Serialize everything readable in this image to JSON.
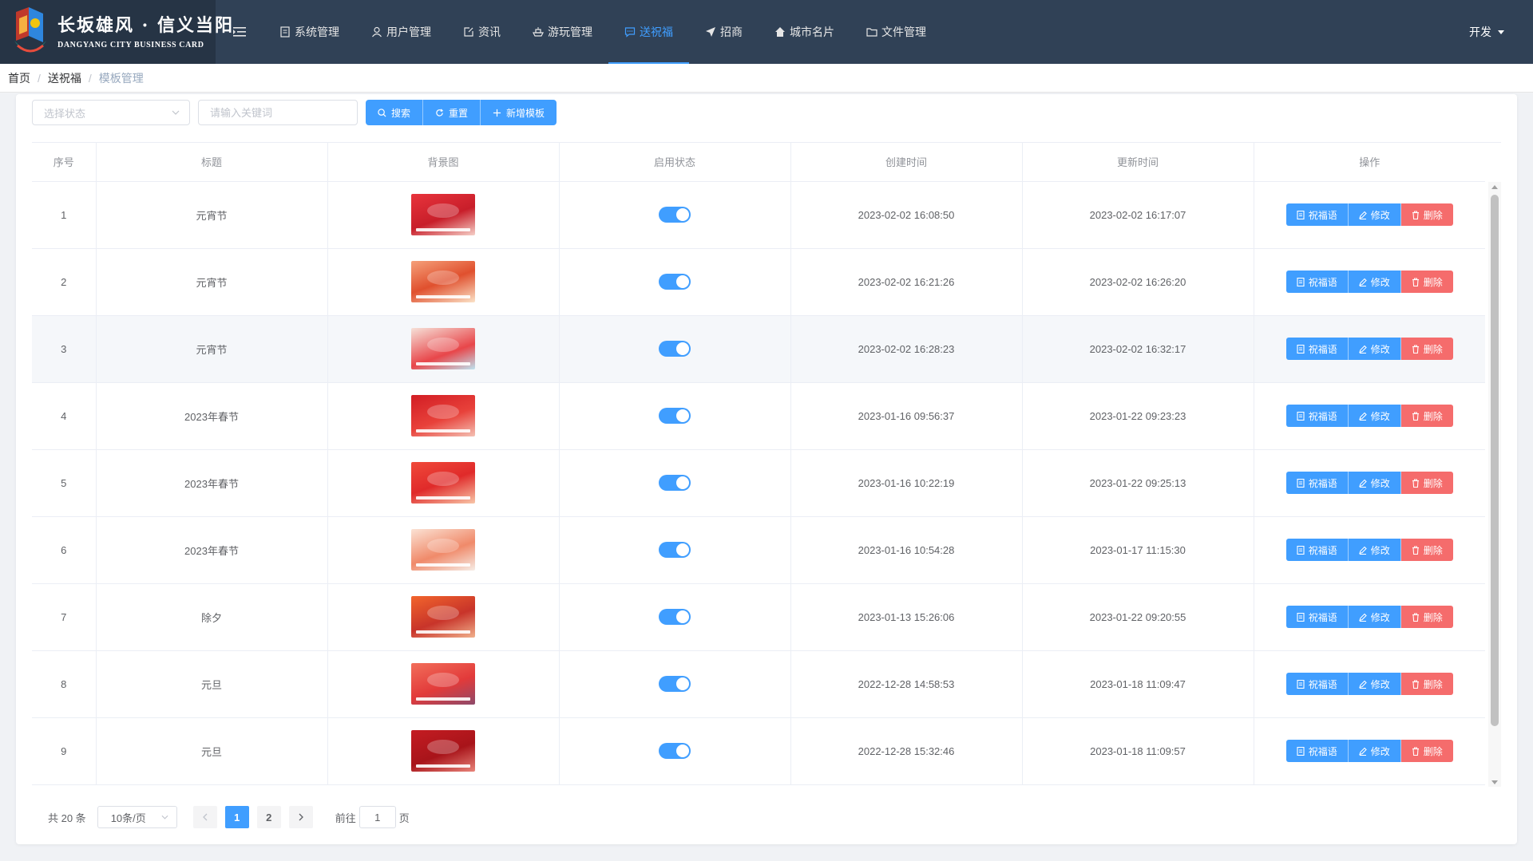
{
  "header": {
    "logo_title": "长坂雄风 · 信义当阳",
    "logo_subtitle": "DANGYANG CITY BUSINESS CARD",
    "nav": [
      {
        "label": "系统管理",
        "icon": "document-icon"
      },
      {
        "label": "用户管理",
        "icon": "user-icon"
      },
      {
        "label": "资讯",
        "icon": "edit-icon"
      },
      {
        "label": "游玩管理",
        "icon": "ship-icon"
      },
      {
        "label": "送祝福",
        "icon": "chat-icon",
        "active": true
      },
      {
        "label": "招商",
        "icon": "send-icon"
      },
      {
        "label": "城市名片",
        "icon": "home-icon"
      },
      {
        "label": "文件管理",
        "icon": "folder-icon"
      }
    ],
    "user_name": "开发"
  },
  "breadcrumb": [
    "首页",
    "送祝福",
    "模板管理"
  ],
  "filters": {
    "status_placeholder": "选择状态",
    "keyword_placeholder": "请输入关键词",
    "search_label": "搜索",
    "reset_label": "重置",
    "add_label": "新增模板"
  },
  "table": {
    "columns": [
      "序号",
      "标题",
      "背景图",
      "启用状态",
      "创建时间",
      "更新时间",
      "操作"
    ],
    "actions": {
      "blessing": "祝福语",
      "edit": "修改",
      "delete": "删除"
    },
    "rows": [
      {
        "index": "1",
        "title": "元宵节",
        "enabled": true,
        "created": "2023-02-02 16:08:50",
        "updated": "2023-02-02 16:17:07"
      },
      {
        "index": "2",
        "title": "元宵节",
        "enabled": true,
        "created": "2023-02-02 16:21:26",
        "updated": "2023-02-02 16:26:20"
      },
      {
        "index": "3",
        "title": "元宵节",
        "enabled": true,
        "created": "2023-02-02 16:28:23",
        "updated": "2023-02-02 16:32:17"
      },
      {
        "index": "4",
        "title": "2023年春节",
        "enabled": true,
        "created": "2023-01-16 09:56:37",
        "updated": "2023-01-22 09:23:23"
      },
      {
        "index": "5",
        "title": "2023年春节",
        "enabled": true,
        "created": "2023-01-16 10:22:19",
        "updated": "2023-01-22 09:25:13"
      },
      {
        "index": "6",
        "title": "2023年春节",
        "enabled": true,
        "created": "2023-01-16 10:54:28",
        "updated": "2023-01-17 11:15:30"
      },
      {
        "index": "7",
        "title": "除夕",
        "enabled": true,
        "created": "2023-01-13 15:26:06",
        "updated": "2023-01-22 09:20:55"
      },
      {
        "index": "8",
        "title": "元旦",
        "enabled": true,
        "created": "2022-12-28 14:58:53",
        "updated": "2023-01-18 11:09:47"
      },
      {
        "index": "9",
        "title": "元旦",
        "enabled": true,
        "created": "2022-12-28 15:32:46",
        "updated": "2023-01-18 11:09:57"
      }
    ]
  },
  "pagination": {
    "total_text": "共 20 条",
    "page_size": "10条/页",
    "pages": [
      "1",
      "2"
    ],
    "current_page": "1",
    "goto_prefix": "前往",
    "goto_value": "1",
    "goto_suffix": "页"
  },
  "colors": {
    "primary": "#409eff",
    "danger": "#f56c6c",
    "header_bg": "#304156",
    "logo_bg": "#263445"
  }
}
